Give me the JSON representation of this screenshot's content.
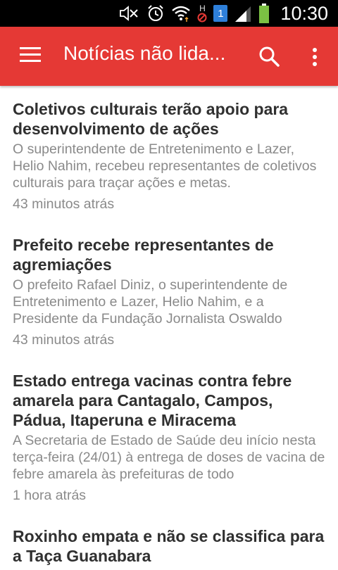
{
  "status_bar": {
    "sim_label": "1",
    "hd_label": "H",
    "time": "10:30",
    "battery_color": "#7bc043"
  },
  "app_bar": {
    "title": "Notícias não lida...",
    "background": "#e53935"
  },
  "news": [
    {
      "title": "Coletivos culturais terão apoio para desenvolvimento de ações",
      "summary": "O superintendente de Entretenimento e Lazer, Helio Nahim, recebeu representantes de coletivos culturais para traçar ações e metas.",
      "time": "43 minutos atrás"
    },
    {
      "title": "Prefeito recebe representantes de agremiações",
      "summary": "O prefeito Rafael Diniz, o superintendente de Entretenimento e Lazer, Helio Nahim, e a Presidente da Fundação Jornalista Oswaldo",
      "time": "43 minutos atrás"
    },
    {
      "title": "Estado entrega vacinas contra febre amarela para Cantagalo, Campos, Pádua, Itaperuna e Miracema",
      "summary": "A Secretaria de Estado de Saúde deu início nesta terça-feira (24/01) à entrega de doses de vacina de febre amarela às prefeituras de todo",
      "time": "1 hora atrás"
    },
    {
      "title": "Roxinho empata e não se classifica para a Taça Guanabara",
      "summary": "",
      "time": ""
    }
  ]
}
